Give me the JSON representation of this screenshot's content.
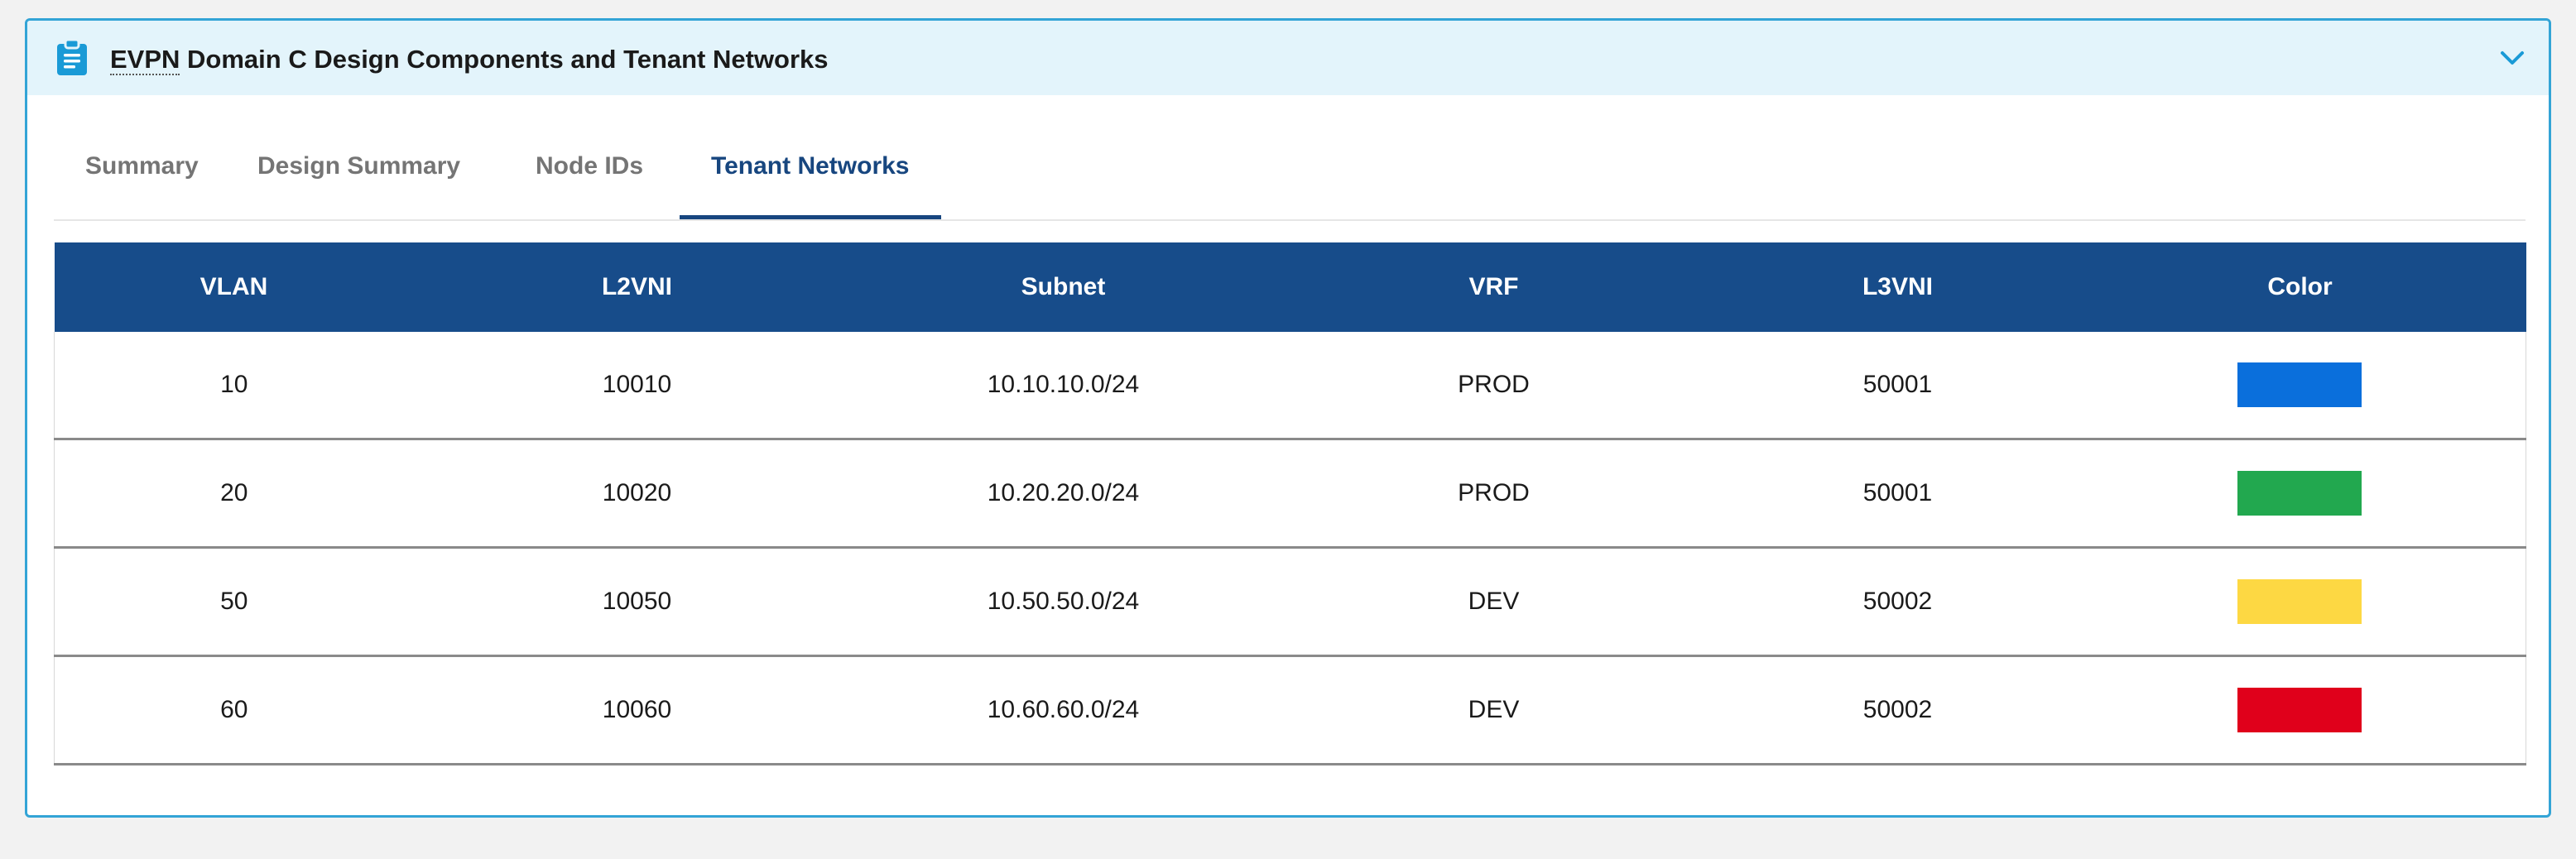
{
  "panel": {
    "title_abbr": "EVPN",
    "title_rest": " Domain C Design Components and Tenant Networks",
    "icon": "clipboard-icon",
    "toggle_icon": "chevron-down-icon"
  },
  "tabs": [
    {
      "label": "Summary",
      "active": false
    },
    {
      "label": "Design Summary",
      "active": false
    },
    {
      "label": "Node IDs",
      "active": false
    },
    {
      "label": "Tenant Networks",
      "active": true
    }
  ],
  "table": {
    "columns": [
      "VLAN",
      "L2VNI",
      "Subnet",
      "VRF",
      "L3VNI",
      "Color"
    ],
    "rows": [
      {
        "vlan": "10",
        "l2vni": "10010",
        "subnet": "10.10.10.0/24",
        "vrf": "PROD",
        "l3vni": "50001",
        "color": "#0a6fdc"
      },
      {
        "vlan": "20",
        "l2vni": "10020",
        "subnet": "10.20.20.0/24",
        "vrf": "PROD",
        "l3vni": "50001",
        "color": "#22a84f"
      },
      {
        "vlan": "50",
        "l2vni": "10050",
        "subnet": "10.50.50.0/24",
        "vrf": "DEV",
        "l3vni": "50002",
        "color": "#fdd843"
      },
      {
        "vlan": "60",
        "l2vni": "10060",
        "subnet": "10.60.60.0/24",
        "vrf": "DEV",
        "l3vni": "50002",
        "color": "#e0001b"
      }
    ]
  },
  "colors": {
    "accent": "#17467f",
    "header_bg": "#174c8a",
    "panel_border": "#33a4d6",
    "panel_header_bg": "#e3f4fb"
  }
}
